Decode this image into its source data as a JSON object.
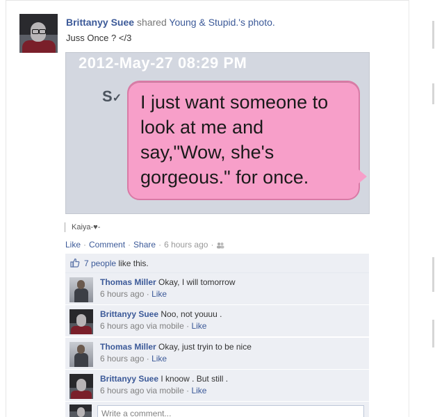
{
  "post": {
    "author": "Brittanyy Suee",
    "shared_text": "shared",
    "target": "Young & Stupid.",
    "target_suffix": "'s photo.",
    "caption": "Juss Once ? </3",
    "photo": {
      "timestamp": "2012-May-27  08:29 PM",
      "sender_mark": "S",
      "bubble_text": "I just want someone to\nlook at me and\nsay,\"Wow, she's\ngorgeous.\" for once.",
      "bubble_color": "#f79fc9"
    },
    "via": "Kaiya-♥-",
    "actions": {
      "like": "Like",
      "comment": "Comment",
      "share": "Share",
      "time": "6 hours ago"
    },
    "likes": {
      "count": "7 people",
      "suffix": "like this."
    },
    "comments": [
      {
        "name": "Thomas Miller",
        "text": "Okay, I will tomorrow",
        "time": "6 hours ago",
        "via": "",
        "like": "Like",
        "avatar": "boy"
      },
      {
        "name": "Brittanyy Suee",
        "text": "Noo, not youuu .",
        "time": "6 hours ago",
        "via": "via mobile",
        "like": "Like",
        "avatar": "girl"
      },
      {
        "name": "Thomas Miller",
        "text": "Okay, just tryin to be nice",
        "time": "6 hours ago",
        "via": "",
        "like": "Like",
        "avatar": "boy"
      },
      {
        "name": "Brittanyy Suee",
        "text": "I knoow . But still .",
        "time": "6 hours ago",
        "via": "via mobile",
        "like": "Like",
        "avatar": "girl"
      }
    ],
    "write_placeholder": "Write a comment..."
  },
  "colors": {
    "link": "#3b5998",
    "comment_bg": "#edeff4"
  }
}
